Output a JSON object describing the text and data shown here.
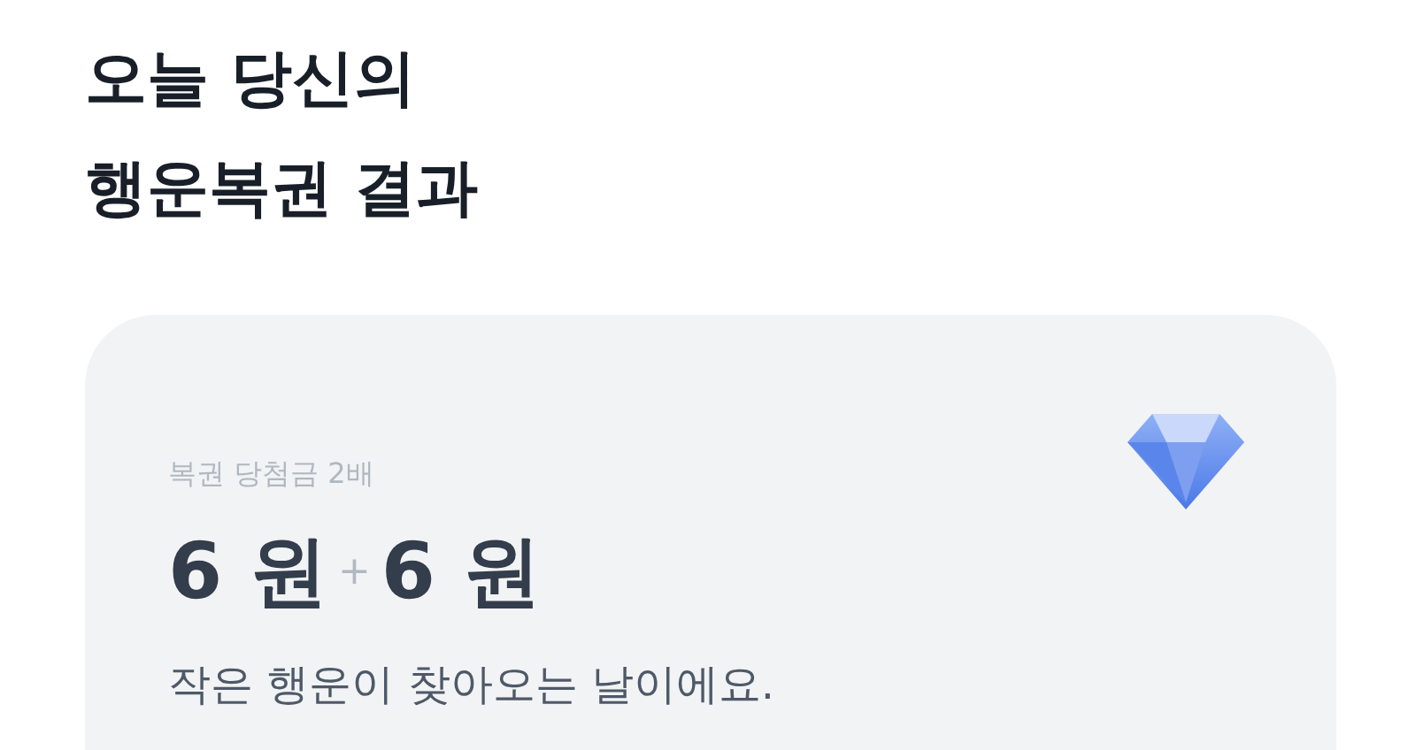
{
  "title_lines": [
    "오늘 당신의",
    "행운복권 결과"
  ],
  "result_card": {
    "label": "복권 당첨금 2배",
    "amounts": [
      "6 원",
      "6 원"
    ],
    "plus": "+",
    "message": "작은 행운이 찾아오는 날이에요."
  }
}
